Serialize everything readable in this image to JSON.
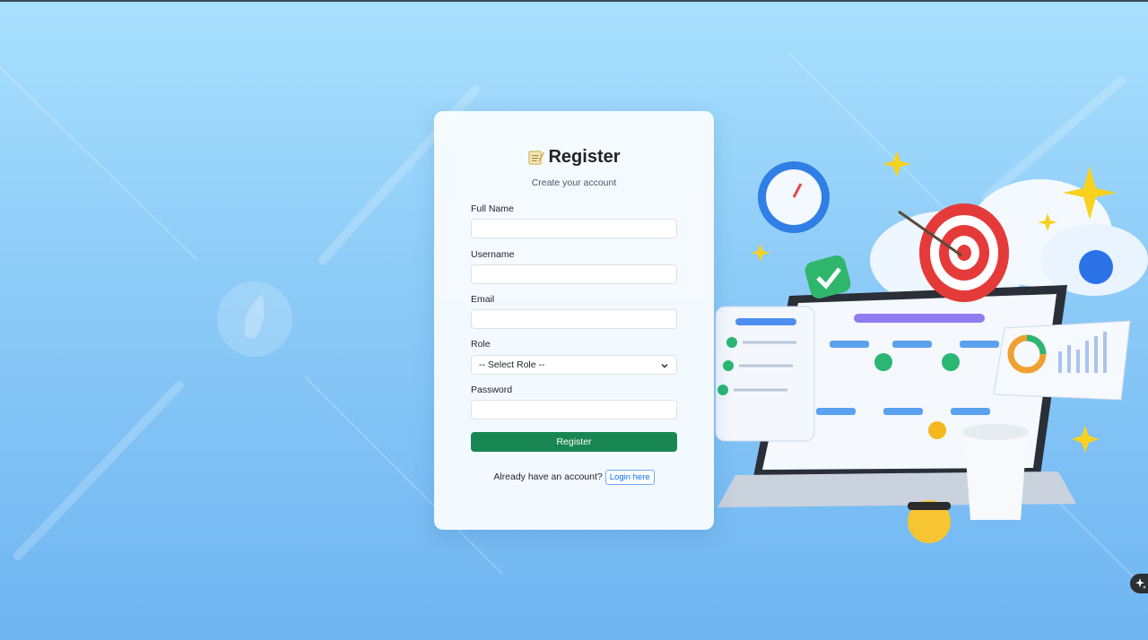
{
  "form": {
    "title": "Register",
    "title_icon": "memo-icon",
    "subtitle": "Create your account",
    "fields": {
      "full_name": {
        "label": "Full Name",
        "value": "",
        "placeholder": ""
      },
      "username": {
        "label": "Username",
        "value": "",
        "placeholder": ""
      },
      "email": {
        "label": "Email",
        "value": "",
        "placeholder": ""
      },
      "role": {
        "label": "Role",
        "selected": "-- Select Role --"
      },
      "password": {
        "label": "Password",
        "value": "",
        "placeholder": ""
      }
    },
    "submit_label": "Register",
    "footer_text": "Already have an account?",
    "login_link_label": "Login here"
  },
  "colors": {
    "primary_button": "#198754",
    "link": "#0d6efd",
    "background_top": "#a9e0fd",
    "background_bottom": "#6fb5f2"
  }
}
